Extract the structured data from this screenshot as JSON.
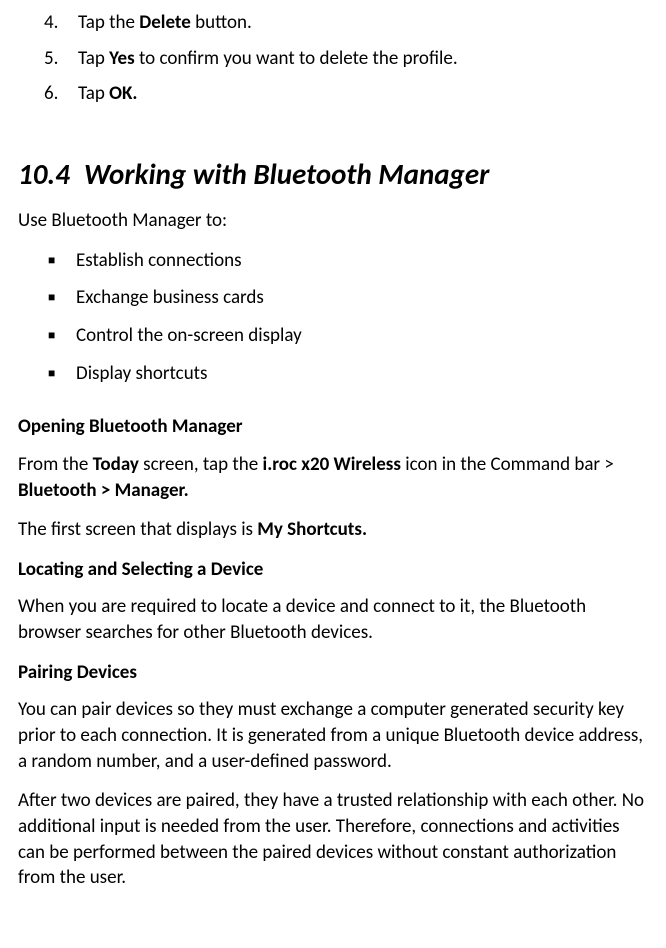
{
  "ordered": [
    {
      "num": "4.",
      "pre": "Tap the ",
      "bold": "Delete",
      "post": " button."
    },
    {
      "num": "5.",
      "pre": "Tap ",
      "bold": "Yes",
      "post": " to confirm you want to delete the profile."
    },
    {
      "num": "6.",
      "pre": "Tap ",
      "bold": "OK.",
      "post": ""
    }
  ],
  "section": {
    "number": "10.4",
    "title": "Working with Bluetooth Manager"
  },
  "intro": "Use Bluetooth Manager to:",
  "bullets": [
    "Establish connections",
    "Exchange business cards",
    "Control the on-screen display",
    "Display shortcuts"
  ],
  "heading_opening": "Opening Bluetooth Manager",
  "from_line": {
    "p1": "From the ",
    "b1": "Today",
    "p2": " screen, tap the ",
    "b2": "i.roc x20 Wireless",
    "p3": " icon in the Command bar > ",
    "b3": "Bluetooth > Manager."
  },
  "first_screen": {
    "p1": "The first screen that displays is ",
    "b1": "My Shortcuts."
  },
  "heading_locating": "Locating and Selecting a Device",
  "locating_text": "When you are required to locate a device and connect to it, the Bluetooth browser searches for other Bluetooth devices.",
  "heading_pairing": "Pairing Devices",
  "pairing_p1": "You can pair devices so they must exchange a computer generated security key prior to each connection. It is generated from a unique Bluetooth device address, a random number, and a user-defined password.",
  "pairing_p2": "After two devices are paired, they have a trusted relationship with each other. No additional input is needed from the user. Therefore, connections and activities can be performed between the paired devices without constant authorization from the user."
}
